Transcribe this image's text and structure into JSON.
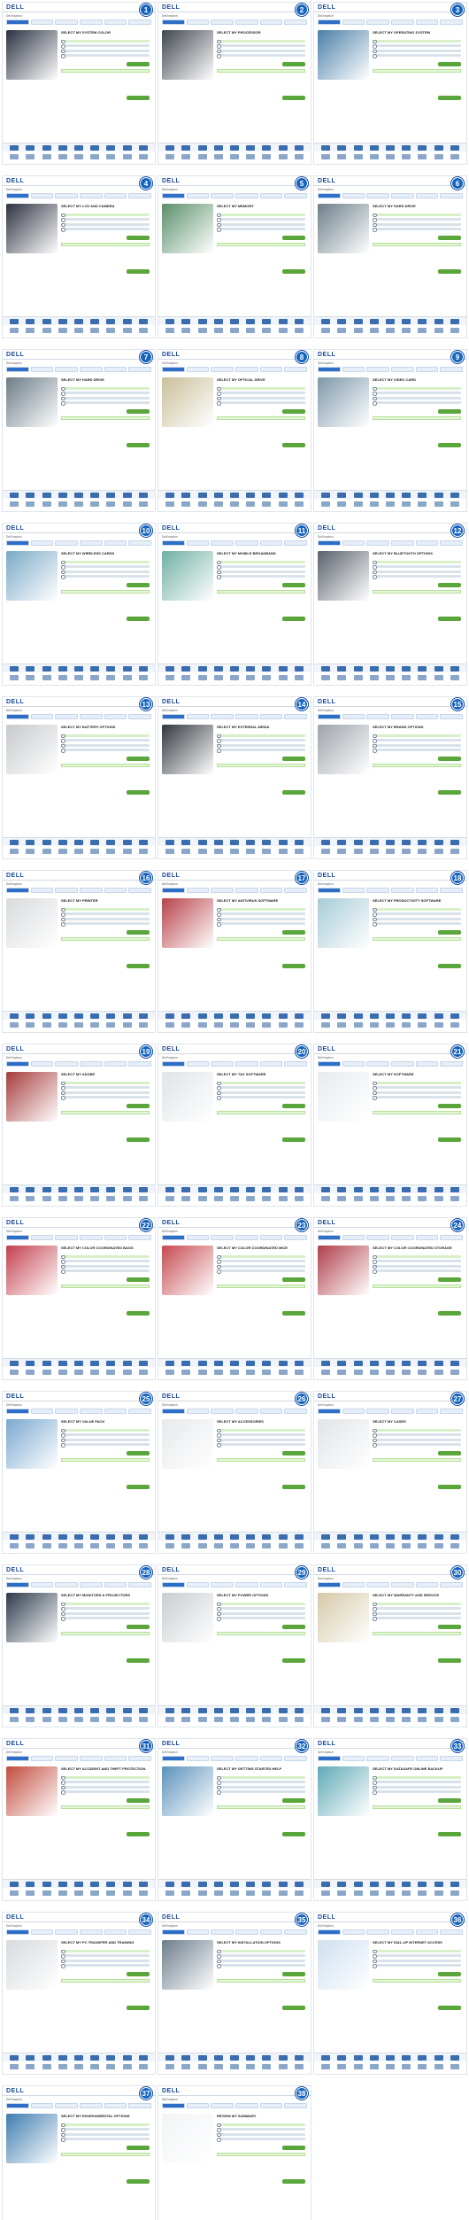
{
  "logo": "DELL",
  "subtitle": "Dell Inspiron",
  "panels": [
    {
      "n": "1",
      "title": "SELECT MY SYSTEM COLOR",
      "color": "#2a3140"
    },
    {
      "n": "2",
      "title": "SELECT MY PROCESSOR",
      "color": "#40464f"
    },
    {
      "n": "3",
      "title": "SELECT MY OPERATING SYSTEM",
      "color": "#4a7fa8"
    },
    {
      "n": "4",
      "title": "SELECT MY LCD AND CAMERA",
      "color": "#2d3240"
    },
    {
      "n": "5",
      "title": "SELECT MY MEMORY",
      "color": "#5a8f6a"
    },
    {
      "n": "6",
      "title": "SELECT MY HARD DRIVE",
      "color": "#6d7f8a"
    },
    {
      "n": "7",
      "title": "SELECT MY HARD DRIVE",
      "color": "#6b7c87"
    },
    {
      "n": "8",
      "title": "SELECT MY OPTICAL DRIVE",
      "color": "#c9bf9a"
    },
    {
      "n": "9",
      "title": "SELECT MY VIDEO CARD",
      "color": "#7e98ab"
    },
    {
      "n": "10",
      "title": "SELECT MY WIRELESS CARDS",
      "color": "#7aa9c6"
    },
    {
      "n": "11",
      "title": "SELECT MY MOBILE BROADBAND",
      "color": "#6fb0a3"
    },
    {
      "n": "12",
      "title": "SELECT MY BLUETOOTH OPTIONS",
      "color": "#59616b"
    },
    {
      "n": "13",
      "title": "SELECT MY BATTERY OPTIONS",
      "color": "#c6c9cc"
    },
    {
      "n": "14",
      "title": "SELECT MY EXTERNAL MEDIA",
      "color": "#32373f"
    },
    {
      "n": "15",
      "title": "SELECT MY BRAND OPTIONS",
      "color": "#9da3aa"
    },
    {
      "n": "16",
      "title": "SELECT MY PRINTER",
      "color": "#d8dadc"
    },
    {
      "n": "17",
      "title": "SELECT MY ANTIVIRUS SOFTWARE",
      "color": "#b8424a"
    },
    {
      "n": "18",
      "title": "SELECT MY PRODUCTIVITY SOFTWARE",
      "color": "#a6cbd6"
    },
    {
      "n": "19",
      "title": "SELECT MY ADOBE",
      "color": "#a63c3c"
    },
    {
      "n": "20",
      "title": "SELECT MY TAX SOFTWARE",
      "color": "#e0e4e8"
    },
    {
      "n": "21",
      "title": "SELECT MY SOFTWARE",
      "color": "#e8ebee"
    },
    {
      "n": "22",
      "title": "SELECT MY COLOR COORDINATED BAGS",
      "color": "#c3414e"
    },
    {
      "n": "23",
      "title": "SELECT MY COLOR COORDINATED MICE",
      "color": "#c64a4f"
    },
    {
      "n": "24",
      "title": "SELECT MY COLOR COORDINATED STORAGE",
      "color": "#b03e4a"
    },
    {
      "n": "25",
      "title": "SELECT MY VALUE PACK",
      "color": "#7aa8d0"
    },
    {
      "n": "26",
      "title": "SELECT MY ACCESSORIES",
      "color": "#e7e9ec"
    },
    {
      "n": "27",
      "title": "SELECT MY CASES",
      "color": "#e1e4e7"
    },
    {
      "n": "28",
      "title": "SELECT MY MONITORS & PROJECTORS",
      "color": "#2b3a4a"
    },
    {
      "n": "29",
      "title": "SELECT MY POWER OPTIONS",
      "color": "#c9cdd1"
    },
    {
      "n": "30",
      "title": "SELECT MY WARRANTY AND SERVICE",
      "color": "#d4c9a7"
    },
    {
      "n": "31",
      "title": "SELECT MY ACCIDENT AND THEFT PROTECTION",
      "color": "#c24c3e"
    },
    {
      "n": "32",
      "title": "SELECT MY GETTING STARTED HELP",
      "color": "#5b92bc"
    },
    {
      "n": "33",
      "title": "SELECT MY DATASAFE ONLINE BACKUP",
      "color": "#5fa9b6"
    },
    {
      "n": "34",
      "title": "SELECT MY PC TRANSFER AND TRAINING",
      "color": "#d7dbdf"
    },
    {
      "n": "35",
      "title": "SELECT MY INSTALLATION OPTIONS",
      "color": "#6c7e8c"
    },
    {
      "n": "36",
      "title": "SELECT MY DIAL-UP INTERNET ACCESS",
      "color": "#cfe0f0"
    },
    {
      "n": "37",
      "title": "SELECT MY ENVIRONMENTAL OPTIONS",
      "color": "#3f7db0"
    },
    {
      "n": "38",
      "title": "REVIEW MY SUMMARY",
      "color": "#f2f4f6"
    }
  ]
}
